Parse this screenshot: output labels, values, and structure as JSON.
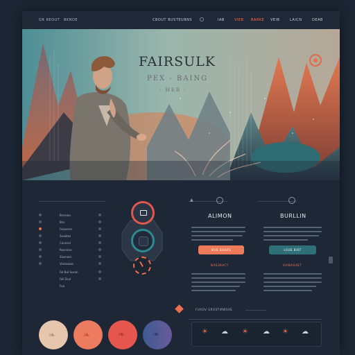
{
  "nav": {
    "brand_left": "GR REOUT",
    "brand_right": "BKNOE",
    "search_text": "CBOUT BUSTEUBNS",
    "items": [
      "IAB",
      "VIEB",
      "BARKE",
      "VEIB",
      "LAICN",
      "DEAB"
    ]
  },
  "hero": {
    "title": "FAIRSULK",
    "subtitle": "PEX - BAING",
    "tag": "- HER -"
  },
  "sidebar": {
    "items": [
      "Brossaa",
      "Bns",
      "Fesaenss",
      "Soubtes",
      "Counsel",
      "Resnisse",
      "Siasnoss",
      "Vaisanaas",
      "Fal Bul Susan",
      "Fall Ssul",
      "Fuo"
    ]
  },
  "columns": [
    {
      "title": "ALIMON",
      "button": "MUE BAORS",
      "link": "NAEUKACT"
    },
    {
      "title": "BURLLIN",
      "button": "LOUE BIRT",
      "link": "SAIBAUAET"
    }
  ],
  "footer": {
    "section_label": "FUROV GROSTIRWSAE",
    "swatch_colors": [
      "#e6c7ae",
      "#ec7b5f",
      "#e5574e",
      "#4f6ea3"
    ],
    "icon_names": [
      "sun-icon",
      "cloud-icon",
      "sun-icon",
      "cloud-icon",
      "sun-icon",
      "cloud-icon"
    ]
  },
  "colors": {
    "accent": "#ef6d4f",
    "teal": "#2e6f78",
    "bg": "#1d2735"
  }
}
